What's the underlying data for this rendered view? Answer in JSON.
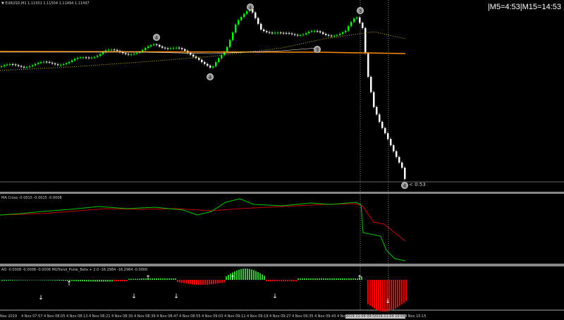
{
  "main": {
    "title": "▼ EURUSD,M1  1.11501 1.11504 1.11494 1.11497",
    "timer": "|M5=4:53|M15=14:53",
    "countdown": "< 0:53",
    "wave_labels": [
      "4",
      "4",
      "4",
      "3",
      "3",
      "4"
    ],
    "colors": {
      "bull": "#00ff00",
      "bear": "#ffffff",
      "orange_line": "#ff8c00",
      "ma_dotted": "#c8b400"
    }
  },
  "ma_cross": {
    "title": "MA Cross -0.0015 -0.0015 -0.0008",
    "colors": {
      "fast": "#00c800",
      "slow": "#c80000"
    }
  },
  "ao": {
    "title": "AO -0.0008 -0.0008 -0.0008  MGTrend_Pulse_Beta + 2.0 -16.2984 -16.2984 -0.0000",
    "colors": {
      "up": "#32cd32",
      "down": "#ff0000"
    }
  },
  "time_axis": [
    "Nov 2019",
    "4 Nov 07:57",
    "4 Nov 08:05",
    "4 Nov 08:13",
    "4 Nov 08:21",
    "4 Nov 08:30",
    "4 Nov 08:39",
    "4 Nov 08:47",
    "4 Nov 08:55",
    "4 Nov 09:03",
    "4 Nov 09:11",
    "4 Nov 09:19",
    "4 Nov 09:27",
    "4 Nov 09:35",
    "4 Nov 09:43",
    "4 Nov",
    "2019.11.04 09:59",
    "2019.11.04 10:09",
    "4 Nov 10:15"
  ]
}
